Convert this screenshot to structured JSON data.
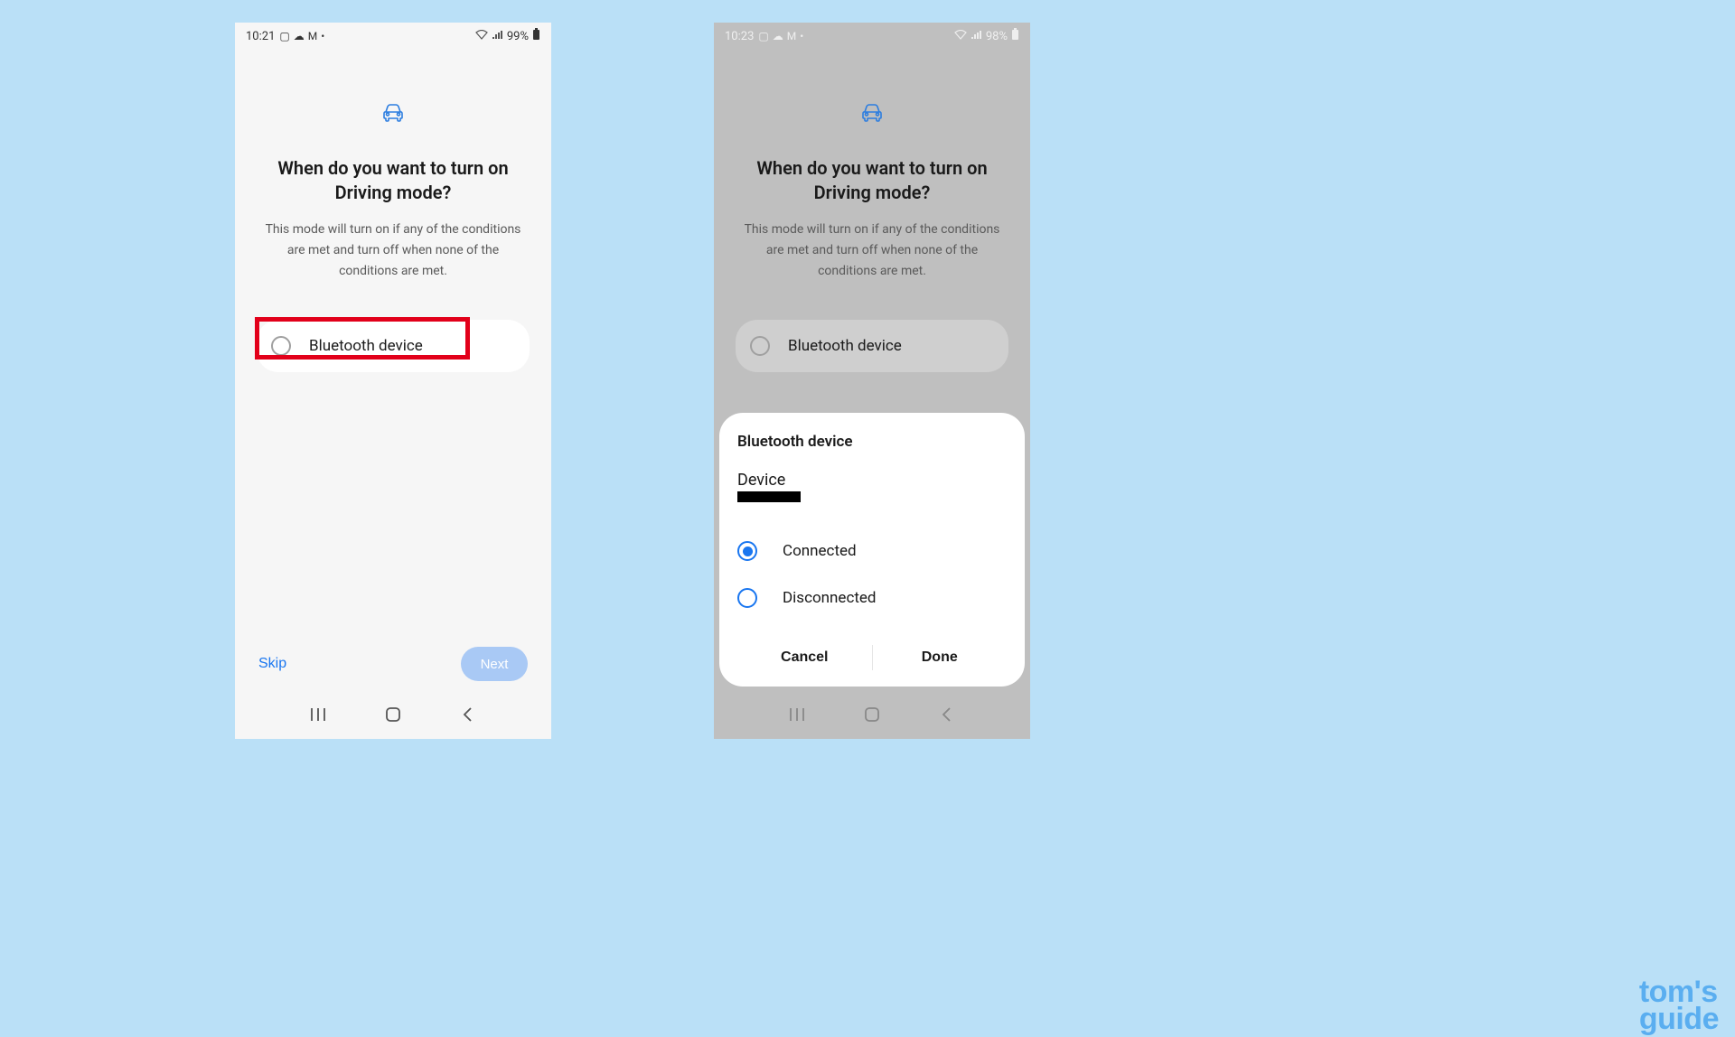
{
  "left": {
    "status": {
      "time": "10:21",
      "battery": "99%"
    },
    "heading": "When do you want to turn on Driving mode?",
    "description": "This mode will turn on if any of the conditions are met and turn off when none of the conditions are met.",
    "option_label": "Bluetooth device",
    "skip": "Skip",
    "next": "Next"
  },
  "right": {
    "status": {
      "time": "10:23",
      "battery": "98%"
    },
    "heading": "When do you want to turn on Driving mode?",
    "description": "This mode will turn on if any of the conditions are met and turn off when none of the conditions are met.",
    "option_label": "Bluetooth device",
    "modal": {
      "title": "Bluetooth device",
      "device_label": "Device",
      "opt_connected": "Connected",
      "opt_disconnected": "Disconnected",
      "cancel": "Cancel",
      "done": "Done"
    }
  },
  "watermark": {
    "line1": "tom's",
    "line2": "guide"
  }
}
